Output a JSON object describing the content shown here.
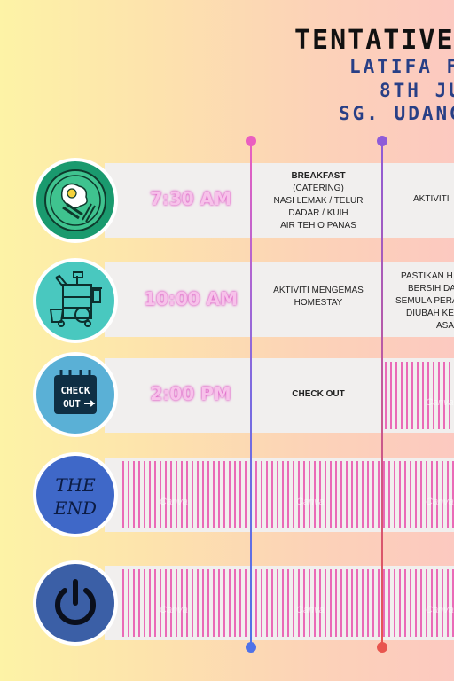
{
  "header": {
    "title": "TENTATIVE",
    "line1": "LATIFA F",
    "line2": "8TH JU",
    "line3": "SG. UDANG"
  },
  "rows": [
    {
      "time": "7:30 AM",
      "col1_title": "BREAKFAST",
      "col1_lines": [
        "(CATERING)",
        "NASI LEMAK / TELUR",
        "DADAR / KUIH",
        "AIR TEH O PANAS"
      ],
      "col2_lines": [
        "AKTIVITI"
      ],
      "icon": "breakfast-icon"
    },
    {
      "time": "10:00 AM",
      "col1_lines": [
        "AKTIVITI MENGEMAS",
        "HOMESTAY"
      ],
      "col2_lines": [
        "PASTIKAN H",
        "BERSIH DA",
        "SEMULA PERA",
        "DIUBAH KE",
        "ASA"
      ],
      "icon": "cleaning-cart-icon"
    },
    {
      "time": "2:00 PM",
      "col1_title": "CHECK OUT",
      "icon": "check-out-icon"
    },
    {
      "icon": "the-end-icon",
      "icon_text": [
        "THE",
        "END"
      ]
    },
    {
      "icon": "power-icon"
    }
  ],
  "watermark": "Canva",
  "colors": {
    "pink_line": "#e85fc0",
    "purple_line": "#8e5cd8",
    "stripe": "#ea6ab7",
    "row_bg": "#f1efee"
  }
}
